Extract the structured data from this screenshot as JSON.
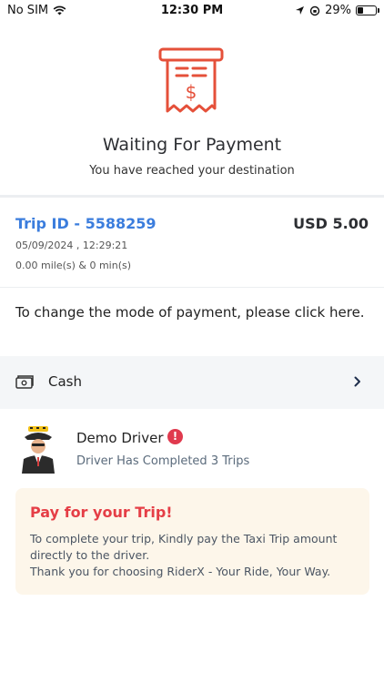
{
  "status_bar": {
    "carrier": "No SIM",
    "time": "12:30 PM",
    "battery": "29%",
    "battery_level": 0.29
  },
  "header": {
    "icon": "receipt-dollar-icon",
    "title": "Waiting For Payment",
    "subtitle": "You have reached your destination"
  },
  "trip": {
    "id_label": "Trip ID - 5588259",
    "amount": "USD 5.00",
    "date": "05/09/2024 , 12:29:21",
    "distance_time": "0.00 mile(s) & 0 min(s)"
  },
  "payment": {
    "note": "To change the mode of payment, please click here.",
    "method_label": "Cash",
    "method_icon": "cash-icon"
  },
  "driver": {
    "name": "Demo Driver",
    "alert_symbol": "!",
    "trips_text": "Driver Has Completed 3 Trips"
  },
  "notice": {
    "title": "Pay for your Trip!",
    "line1": "To complete your trip, Kindly pay the Taxi Trip amount directly to the driver.",
    "line2": "Thank you for choosing RiderX  - Your Ride, Your Way."
  },
  "colors": {
    "accent_blue": "#3b7ddd",
    "accent_red": "#e53e46",
    "notice_bg": "#fdf6ea",
    "icon_red": "#e5503a"
  }
}
